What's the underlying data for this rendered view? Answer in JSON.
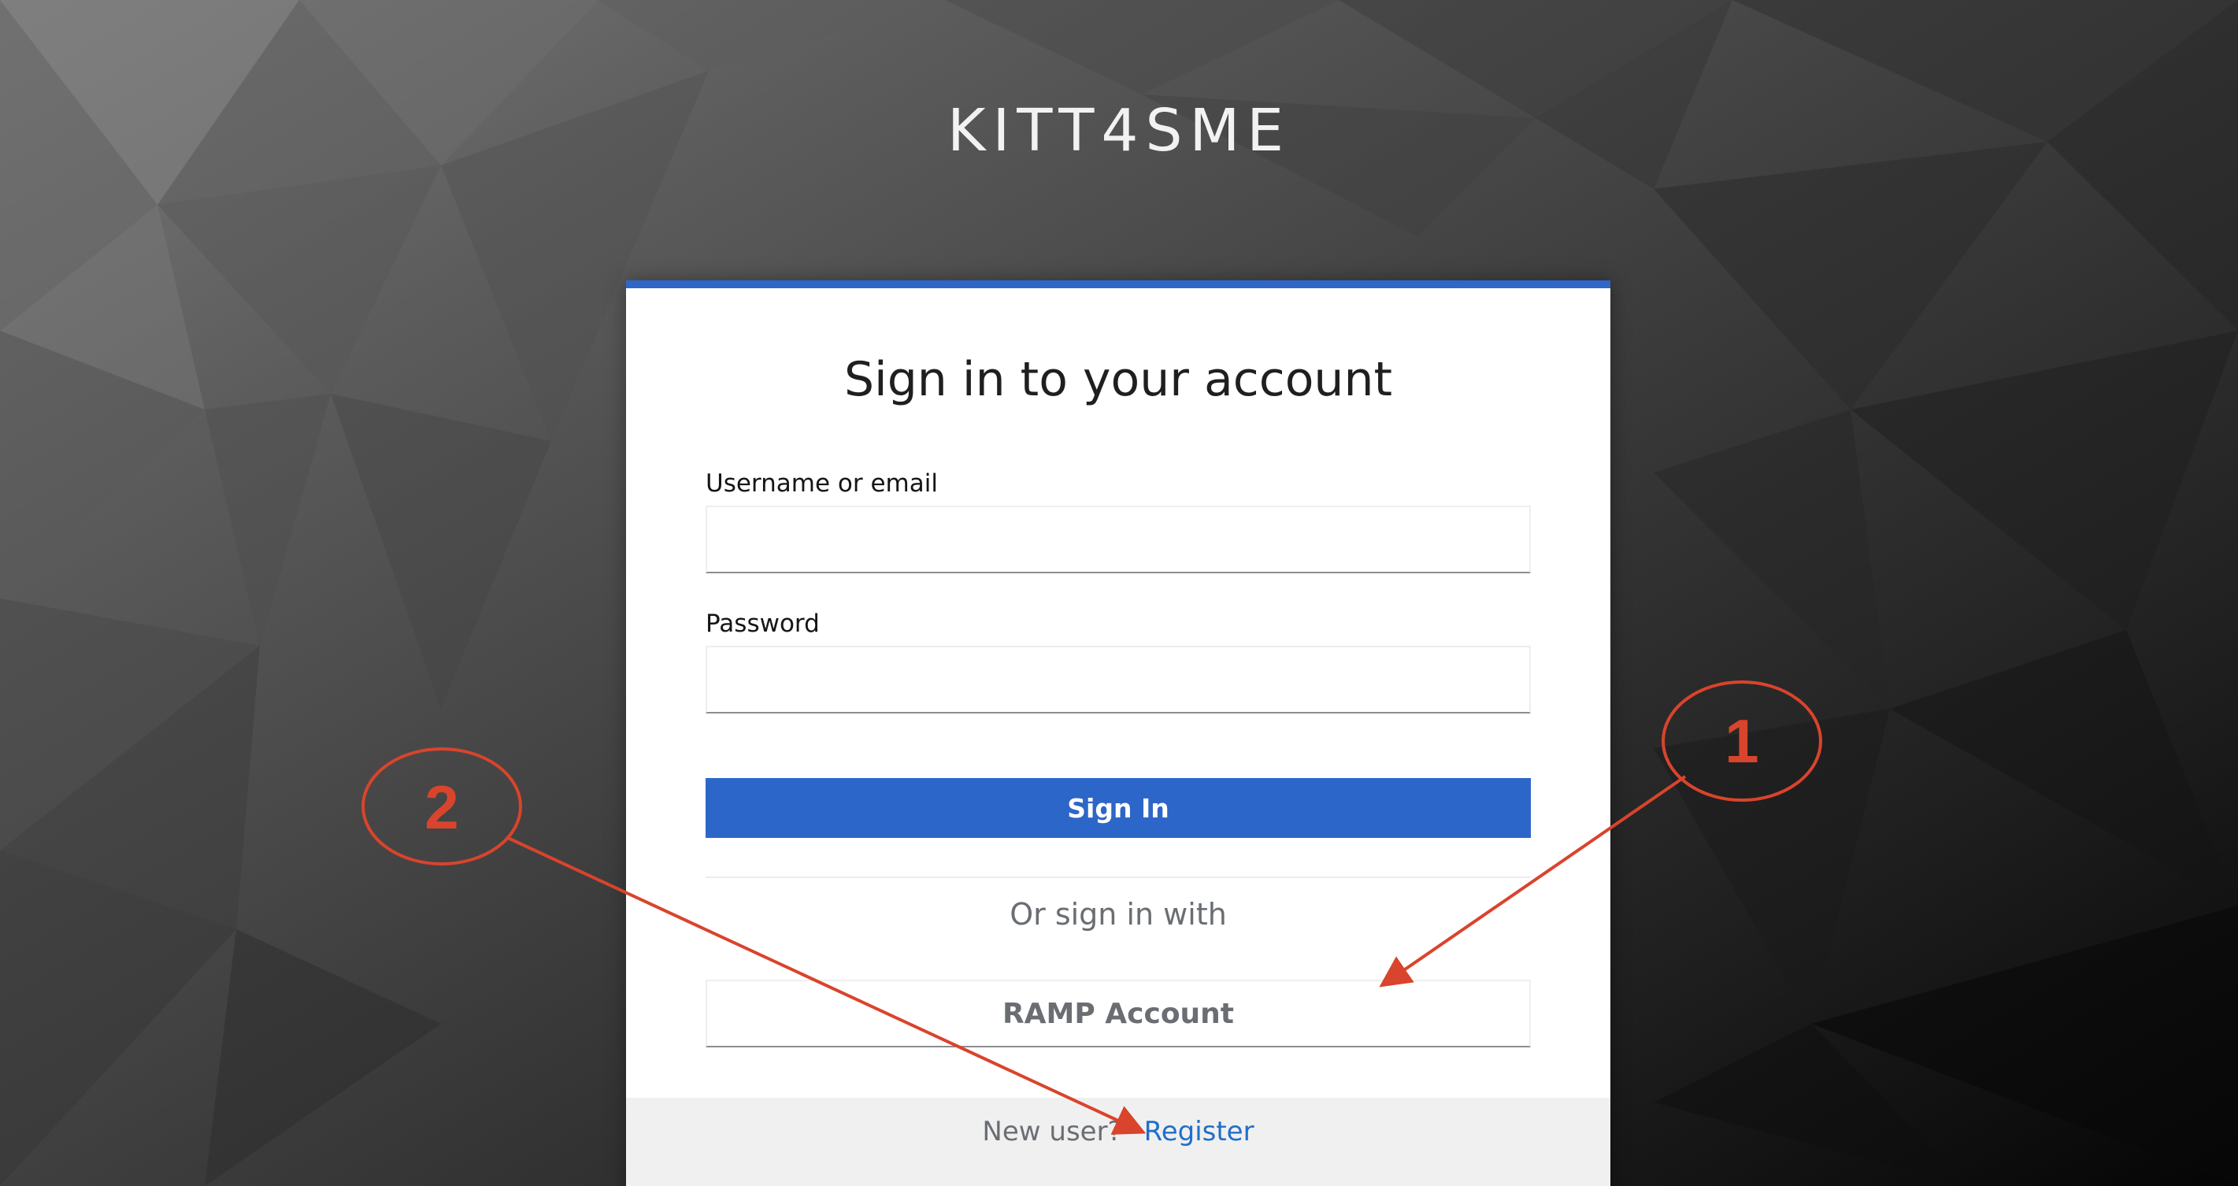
{
  "brand": {
    "title": "KITT4SME"
  },
  "login_card": {
    "title": "Sign in to your account",
    "username_label": "Username or email",
    "username_value": "",
    "password_label": "Password",
    "password_value": "",
    "sign_in_label": "Sign In",
    "or_text": "Or sign in with",
    "ramp_account_label": "RAMP Account",
    "accent_color": "#2d66c9"
  },
  "footer": {
    "new_user_text": "New user?",
    "register_label": "Register"
  },
  "annotations": {
    "color": "#d9442c",
    "items": [
      {
        "number": "1",
        "points_to": "RAMP Account"
      },
      {
        "number": "2",
        "points_to": "Register"
      }
    ]
  }
}
